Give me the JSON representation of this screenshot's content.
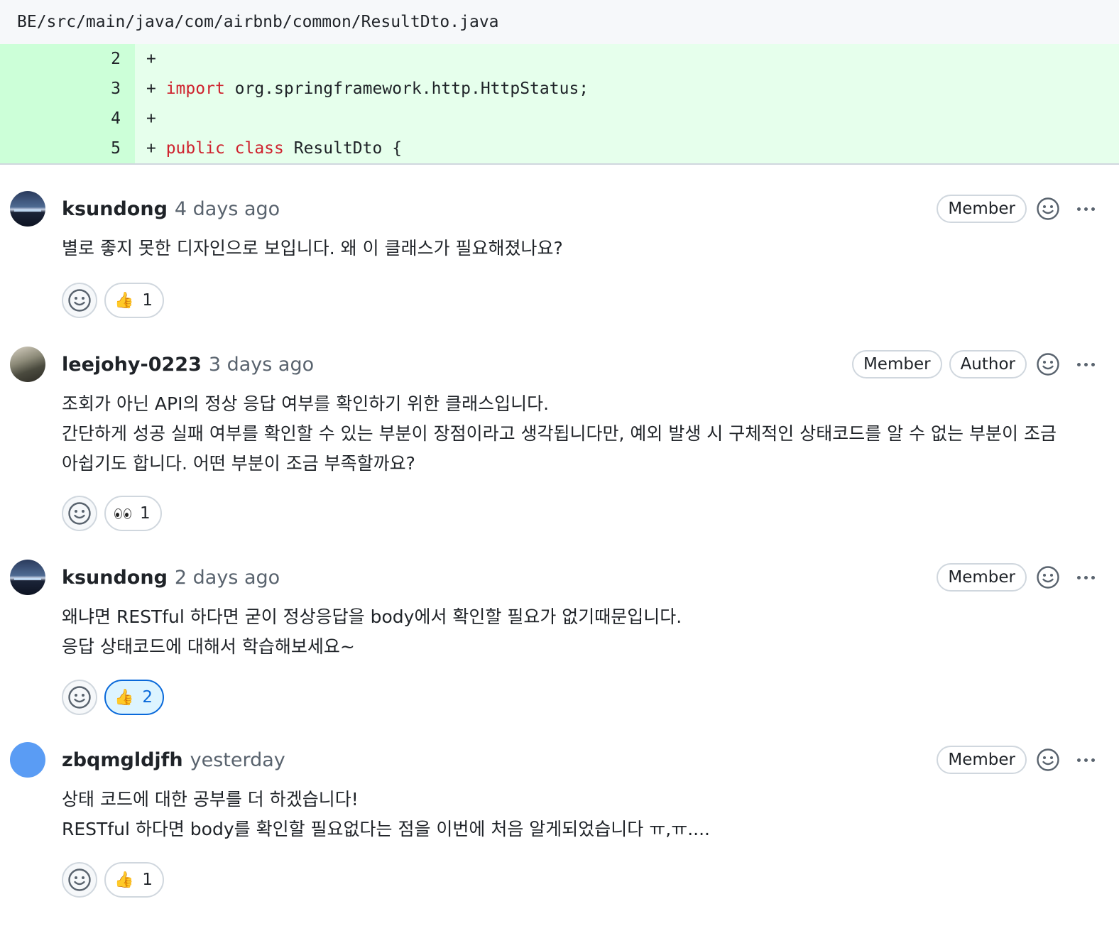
{
  "file": {
    "path": "BE/src/main/java/com/airbnb/common/ResultDto.java"
  },
  "diff": {
    "lines": [
      {
        "num": "2",
        "sign": "+ ",
        "kw": "",
        "rest": ""
      },
      {
        "num": "3",
        "sign": "+ ",
        "kw": "import",
        "rest": " org.springframework.http.HttpStatus;"
      },
      {
        "num": "4",
        "sign": "+ ",
        "kw": "",
        "rest": ""
      },
      {
        "num": "5",
        "sign": "+ ",
        "kw": "public class",
        "rest": " ResultDto {"
      }
    ]
  },
  "comments": [
    {
      "author": "ksundong",
      "time": "4 days ago",
      "badges": [
        "Member"
      ],
      "body": [
        "별로 좋지 못한 디자인으로 보입니다. 왜 이 클래스가 필요해졌나요?"
      ],
      "reaction": {
        "emoji": "👍",
        "icon": "thumbs-up-icon",
        "count": "1",
        "active": false
      }
    },
    {
      "author": "leejohy-0223",
      "time": "3 days ago",
      "badges": [
        "Member",
        "Author"
      ],
      "body": [
        "조회가 아닌 API의 정상 응답 여부를 확인하기 위한 클래스입니다.",
        "간단하게 성공 실패 여부를 확인할 수 있는 부분이 장점이라고 생각됩니다만, 예외 발생 시 구체적인 상태코드를 알 수 없는 부분이 조금",
        "아쉽기도 합니다. 어떤 부분이 조금 부족할까요?"
      ],
      "reaction": {
        "emoji": "👀",
        "icon": "eyes-icon",
        "count": "1",
        "active": false
      }
    },
    {
      "author": "ksundong",
      "time": "2 days ago",
      "badges": [
        "Member"
      ],
      "body": [
        "왜냐면 RESTful 하다면 굳이 정상응답을 body에서 확인할 필요가 없기때문입니다.",
        "응답 상태코드에 대해서 학습해보세요~"
      ],
      "reaction": {
        "emoji": "👍",
        "icon": "thumbs-up-icon",
        "count": "2",
        "active": true
      }
    },
    {
      "author": "zbqmgldjfh",
      "time": "yesterday",
      "badges": [
        "Member"
      ],
      "body": [
        "상태 코드에 대한 공부를 더 하겠습니다!",
        "RESTful 하다면 body를 확인할 필요없다는 점을 이번에 처음 알게되었습니다 ㅠ,ㅠ...."
      ],
      "reaction": {
        "emoji": "👍",
        "icon": "thumbs-up-icon",
        "count": "1",
        "active": false
      }
    }
  ],
  "colors": {
    "accent": "#0969da",
    "diff_added": "#e6ffec",
    "diff_added_num": "#ccffd8",
    "keyword": "#cf222e"
  }
}
